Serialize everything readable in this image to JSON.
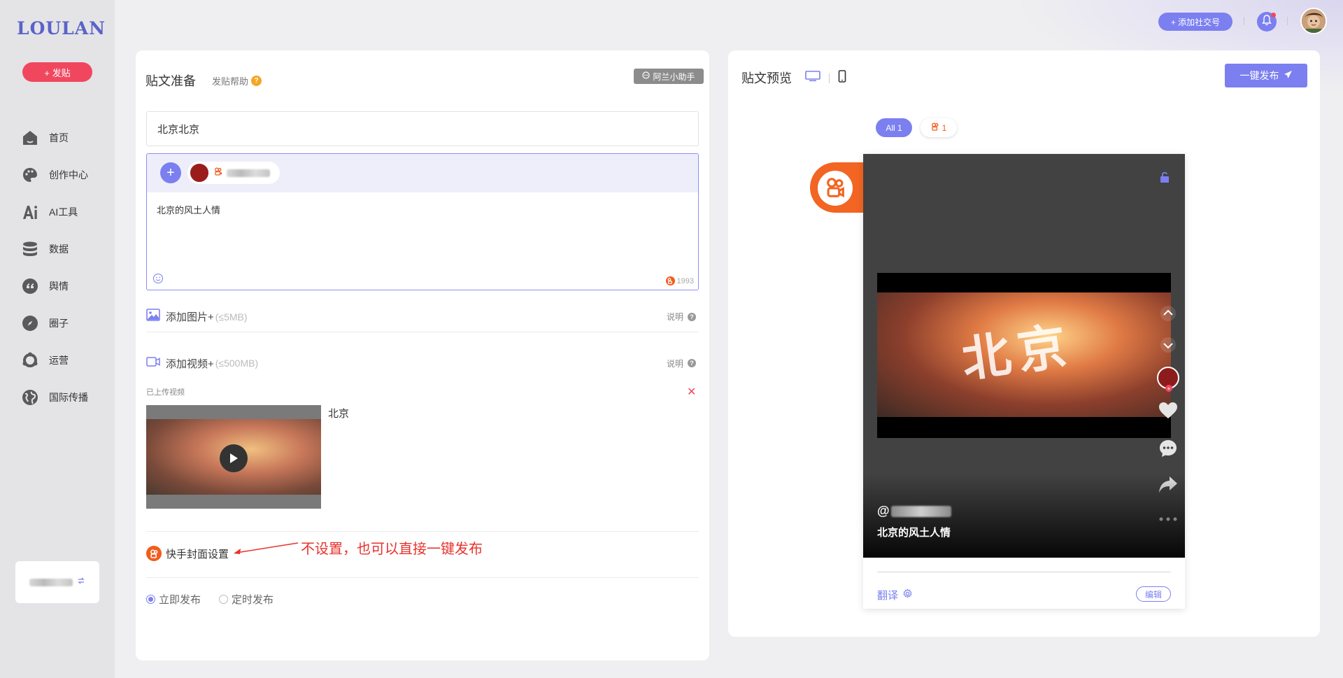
{
  "sidebar": {
    "logo": "LOULAN",
    "post_button": "+ 发贴",
    "items": [
      {
        "label": "首页",
        "icon": "home-icon"
      },
      {
        "label": "创作中心",
        "icon": "palette-icon"
      },
      {
        "label": "AI工具",
        "icon": "ai-icon"
      },
      {
        "label": "数据",
        "icon": "database-icon"
      },
      {
        "label": "舆情",
        "icon": "quote-icon"
      },
      {
        "label": "圈子",
        "icon": "compass-icon"
      },
      {
        "label": "运营",
        "icon": "cycle-icon"
      },
      {
        "label": "国际传播",
        "icon": "globe-icon"
      }
    ]
  },
  "topbar": {
    "add_social": "+ 添加社交号"
  },
  "editor": {
    "title": "贴文准备",
    "help": "发贴帮助",
    "assistant": "阿兰小助手",
    "title_value": "北京北京",
    "content_text": "北京的风土人情",
    "char_count": "1993",
    "add_image": "添加图片+",
    "add_image_limit": "(≤5MB)",
    "add_video": "添加视频+",
    "add_video_limit": "(≤500MB)",
    "note_label": "说明",
    "uploaded_label": "已上传视频",
    "video_name": "北京",
    "cover_setting": "快手封面设置",
    "annotation": "不设置，也可以直接一键发布",
    "publish_now": "立即发布",
    "publish_scheduled": "定时发布"
  },
  "preview": {
    "title": "贴文预览",
    "one_click_publish": "一键发布",
    "filter_all": "All 1",
    "filter_ks_count": "1",
    "handle_prefix": "@",
    "description": "北京的风土人情",
    "video_overlay_text": "北京",
    "translate": "翻译",
    "edit": "编辑"
  },
  "colors": {
    "accent": "#7b7ff0",
    "post_red": "#f0475f",
    "kuaishou_orange": "#f26522",
    "annotation_red": "#e8322c"
  }
}
